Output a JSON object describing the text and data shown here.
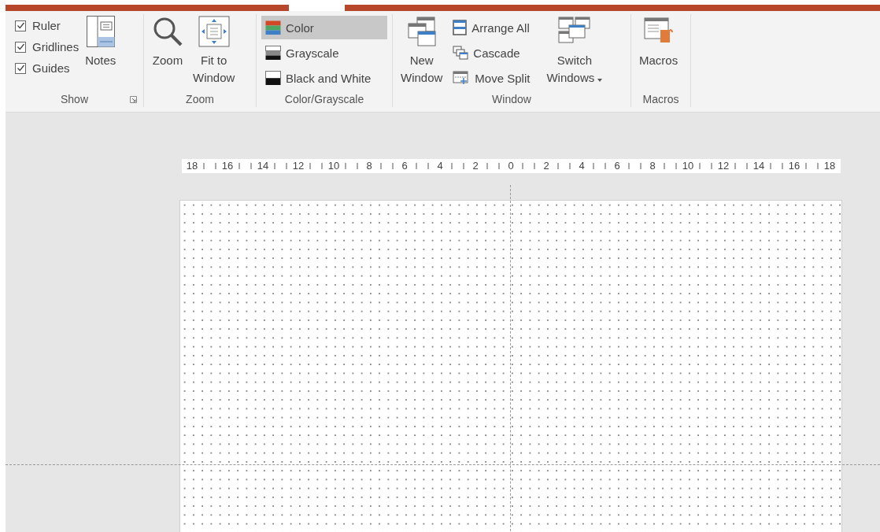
{
  "ribbon": {
    "show": {
      "label": "Show",
      "checkboxes": [
        {
          "label": "Ruler",
          "checked": true
        },
        {
          "label": "Gridlines",
          "checked": true
        },
        {
          "label": "Guides",
          "checked": true
        }
      ],
      "notes": "Notes"
    },
    "zoom": {
      "label": "Zoom",
      "zoom": "Zoom",
      "fit": [
        "Fit to",
        "Window"
      ]
    },
    "color": {
      "label": "Color/Grayscale",
      "modes": [
        {
          "kind": "color",
          "label": "Color",
          "selected": true
        },
        {
          "kind": "grayscale",
          "label": "Grayscale",
          "selected": false
        },
        {
          "kind": "bw",
          "label": "Black and White",
          "selected": false
        }
      ]
    },
    "window": {
      "label": "Window",
      "new_window": [
        "New",
        "Window"
      ],
      "arrange_all": "Arrange All",
      "cascade": "Cascade",
      "move_split": "Move Split",
      "switch_windows": [
        "Switch",
        "Windows"
      ]
    },
    "macros": {
      "label": "Macros",
      "macros": "Macros"
    }
  },
  "ruler": {
    "labels": [
      "18",
      "16",
      "14",
      "12",
      "10",
      "8",
      "6",
      "4",
      "2",
      "0",
      "2",
      "4",
      "6",
      "8",
      "10",
      "12",
      "14",
      "16",
      "18"
    ]
  },
  "guides": {
    "vertical": true,
    "horizontal": true
  }
}
